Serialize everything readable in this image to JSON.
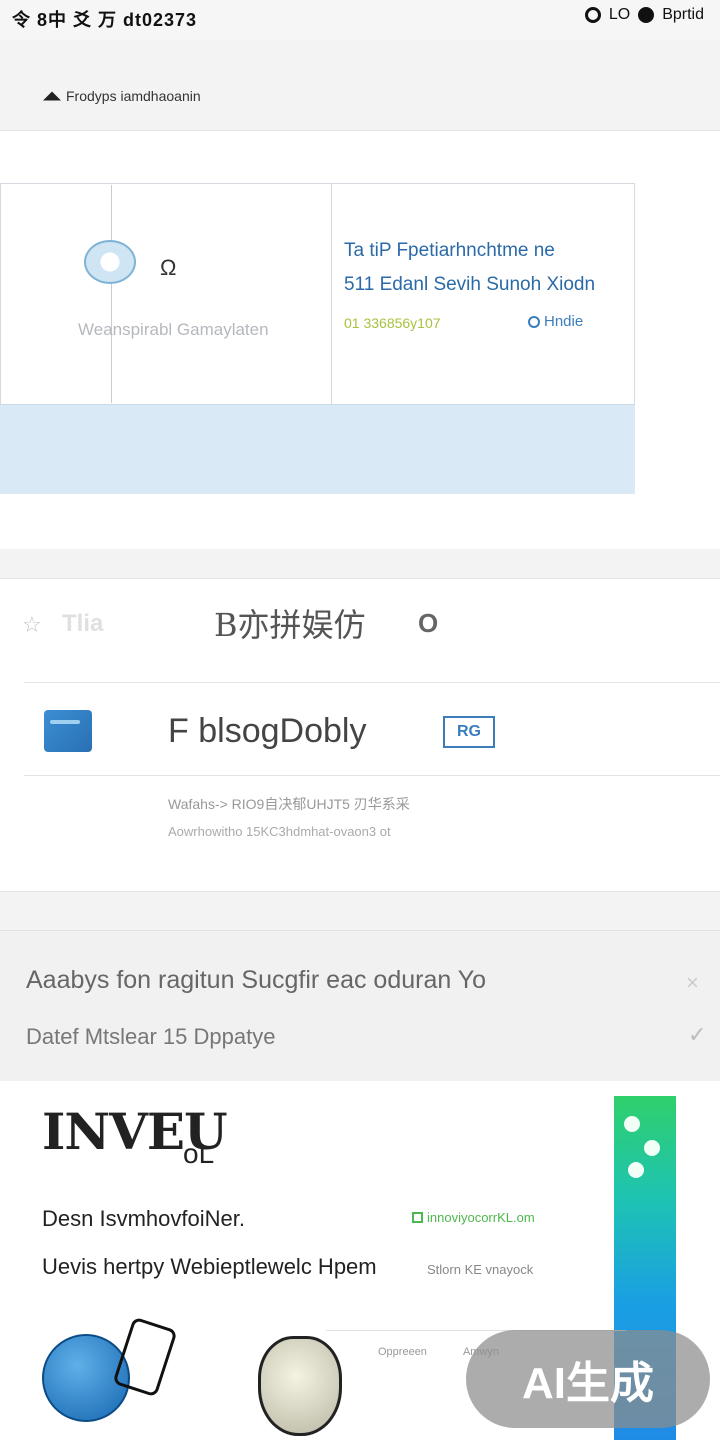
{
  "status_bar": {
    "left_text": "令 8中 爻 万 dt02373",
    "right_labels": [
      "LO",
      "Bprtid"
    ]
  },
  "breadcrumb": {
    "text": "Frodyps iamdhaoanin"
  },
  "card": {
    "left_caption": "Weanspirabl Gamaylaten",
    "aux_label": "Ω",
    "title_line_1": "Ta tiP Fpetiarhnchtme ne",
    "title_line_2": "511 Edanl Sevih Sunoh Xiodn",
    "meta": "01 336856y107",
    "link_label": "Hndie"
  },
  "list": {
    "row1": {
      "star": "☆",
      "muted_label": "Tlia",
      "title": "B亦拼娱仿",
      "badge": "O"
    },
    "row2": {
      "prefix": "F",
      "title": "blsogDobly",
      "badge": "RG"
    },
    "row3": {
      "line1": "Wafahs-> RIO9自决郁UHJT5 刃华系采",
      "line2": "Aowrhowitho 15KC3hdmhat-ovaon3 ot"
    }
  },
  "notice": {
    "line1": "Aaabys fon ragitun Sucgfir eac oduran Yo",
    "line2": "Datef Mtslear 15 Dppatye",
    "close_glyph": "×",
    "check_glyph": "✓"
  },
  "feature": {
    "title": "INVEU",
    "title_suffix": "oL",
    "line_a": "Desn IsvmhovfoiNer.",
    "line_b": "Uevis hertpy Webieptlewelc Hpem",
    "green_tag": "innoviyocorrKL.om",
    "gray_tag": "Stlorn KE vnayock",
    "captions": [
      "Oppreeen",
      "Amwyn"
    ]
  },
  "watermark": "AI生成",
  "colors": {
    "accent_blue": "#2b6aa8",
    "card_footer": "#d9e9f5",
    "meta_green": "#a7c23f",
    "strip_top": "#2fd06b",
    "strip_bottom": "#1f8be6"
  }
}
